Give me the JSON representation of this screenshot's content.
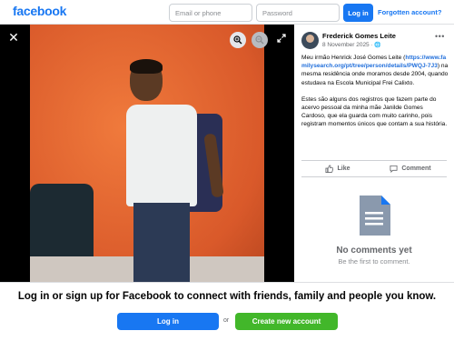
{
  "header": {
    "logo": "facebook",
    "email_placeholder": "Email or phone",
    "password_placeholder": "Password",
    "login_label": "Log in",
    "forgot_label": "Forgotten account?"
  },
  "viewer": {
    "close_icon": "close-icon",
    "zoom_in_icon": "zoom-in-icon",
    "zoom_out_icon": "zoom-out-icon",
    "expand_icon": "expand-icon"
  },
  "post": {
    "author": "Frederick Gomes Leite",
    "date": "8 November 2025",
    "privacy_icon": "globe-icon",
    "more_icon": "more-icon",
    "text_p1_before": "Meu irmão Henrick José Gomes Leite (",
    "text_link": "https://www.familysearch.org/pt/tree/person/details/PWQJ-7J3",
    "text_p1_after": ") na mesma residência onde moramos desde 2004, quando estudava na Escola Municipal Frei Calixto.",
    "text_p2": "Estes são alguns dos registros que fazem parte do acervo pessoal da minha mãe Janilde Gomes Cardoso, que ela guarda com muito carinho, pois registram momentos únicos que contam a sua história.",
    "like_label": "Like",
    "comment_label": "Comment",
    "no_comments_title": "No comments yet",
    "no_comments_sub": "Be the first to comment."
  },
  "banner": {
    "text": "Log in or sign up for Facebook to connect with friends, family and people you know.",
    "login_label": "Log in",
    "or_label": "or",
    "create_label": "Create new account"
  },
  "colors": {
    "brand": "#1877f2",
    "create": "#42b72a"
  }
}
